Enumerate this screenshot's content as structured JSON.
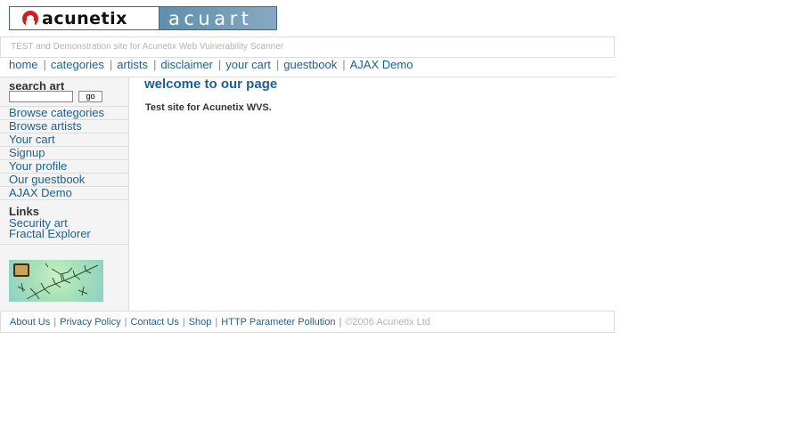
{
  "logo": {
    "left_text": "acunetix",
    "right_text": "acuart"
  },
  "tagline": "TEST and Demonstration site for Acunetix Web Vulnerability Scanner",
  "nav": [
    {
      "label": "home"
    },
    {
      "label": "categories"
    },
    {
      "label": "artists"
    },
    {
      "label": "disclaimer"
    },
    {
      "label": "your cart"
    },
    {
      "label": "guestbook"
    },
    {
      "label": "AJAX Demo"
    }
  ],
  "nav_separator": "|",
  "sidebar": {
    "search_title": "search art",
    "search_value": "",
    "go_label": "go",
    "items": [
      {
        "label": "Browse categories"
      },
      {
        "label": "Browse artists"
      },
      {
        "label": "Your cart"
      },
      {
        "label": "Signup"
      },
      {
        "label": "Your profile"
      },
      {
        "label": "Our guestbook"
      },
      {
        "label": "AJAX Demo"
      }
    ],
    "links_title": "Links",
    "links": [
      {
        "label": "Security art"
      },
      {
        "label": "Fractal Explorer"
      }
    ]
  },
  "main": {
    "title": "welcome to our page",
    "text": "Test site for Acunetix WVS."
  },
  "footer": {
    "links": [
      {
        "label": "About Us"
      },
      {
        "label": "Privacy Policy"
      },
      {
        "label": "Contact Us"
      },
      {
        "label": "Shop"
      },
      {
        "label": "HTTP Parameter Pollution"
      }
    ],
    "separator": "|",
    "copyright": "©2006 Acunetix Ltd"
  },
  "colors": {
    "link": "#1f5f8f",
    "muted": "#b3b3b3",
    "border": "#dcdcdc",
    "sidebar_bg": "#f4f4f4"
  }
}
